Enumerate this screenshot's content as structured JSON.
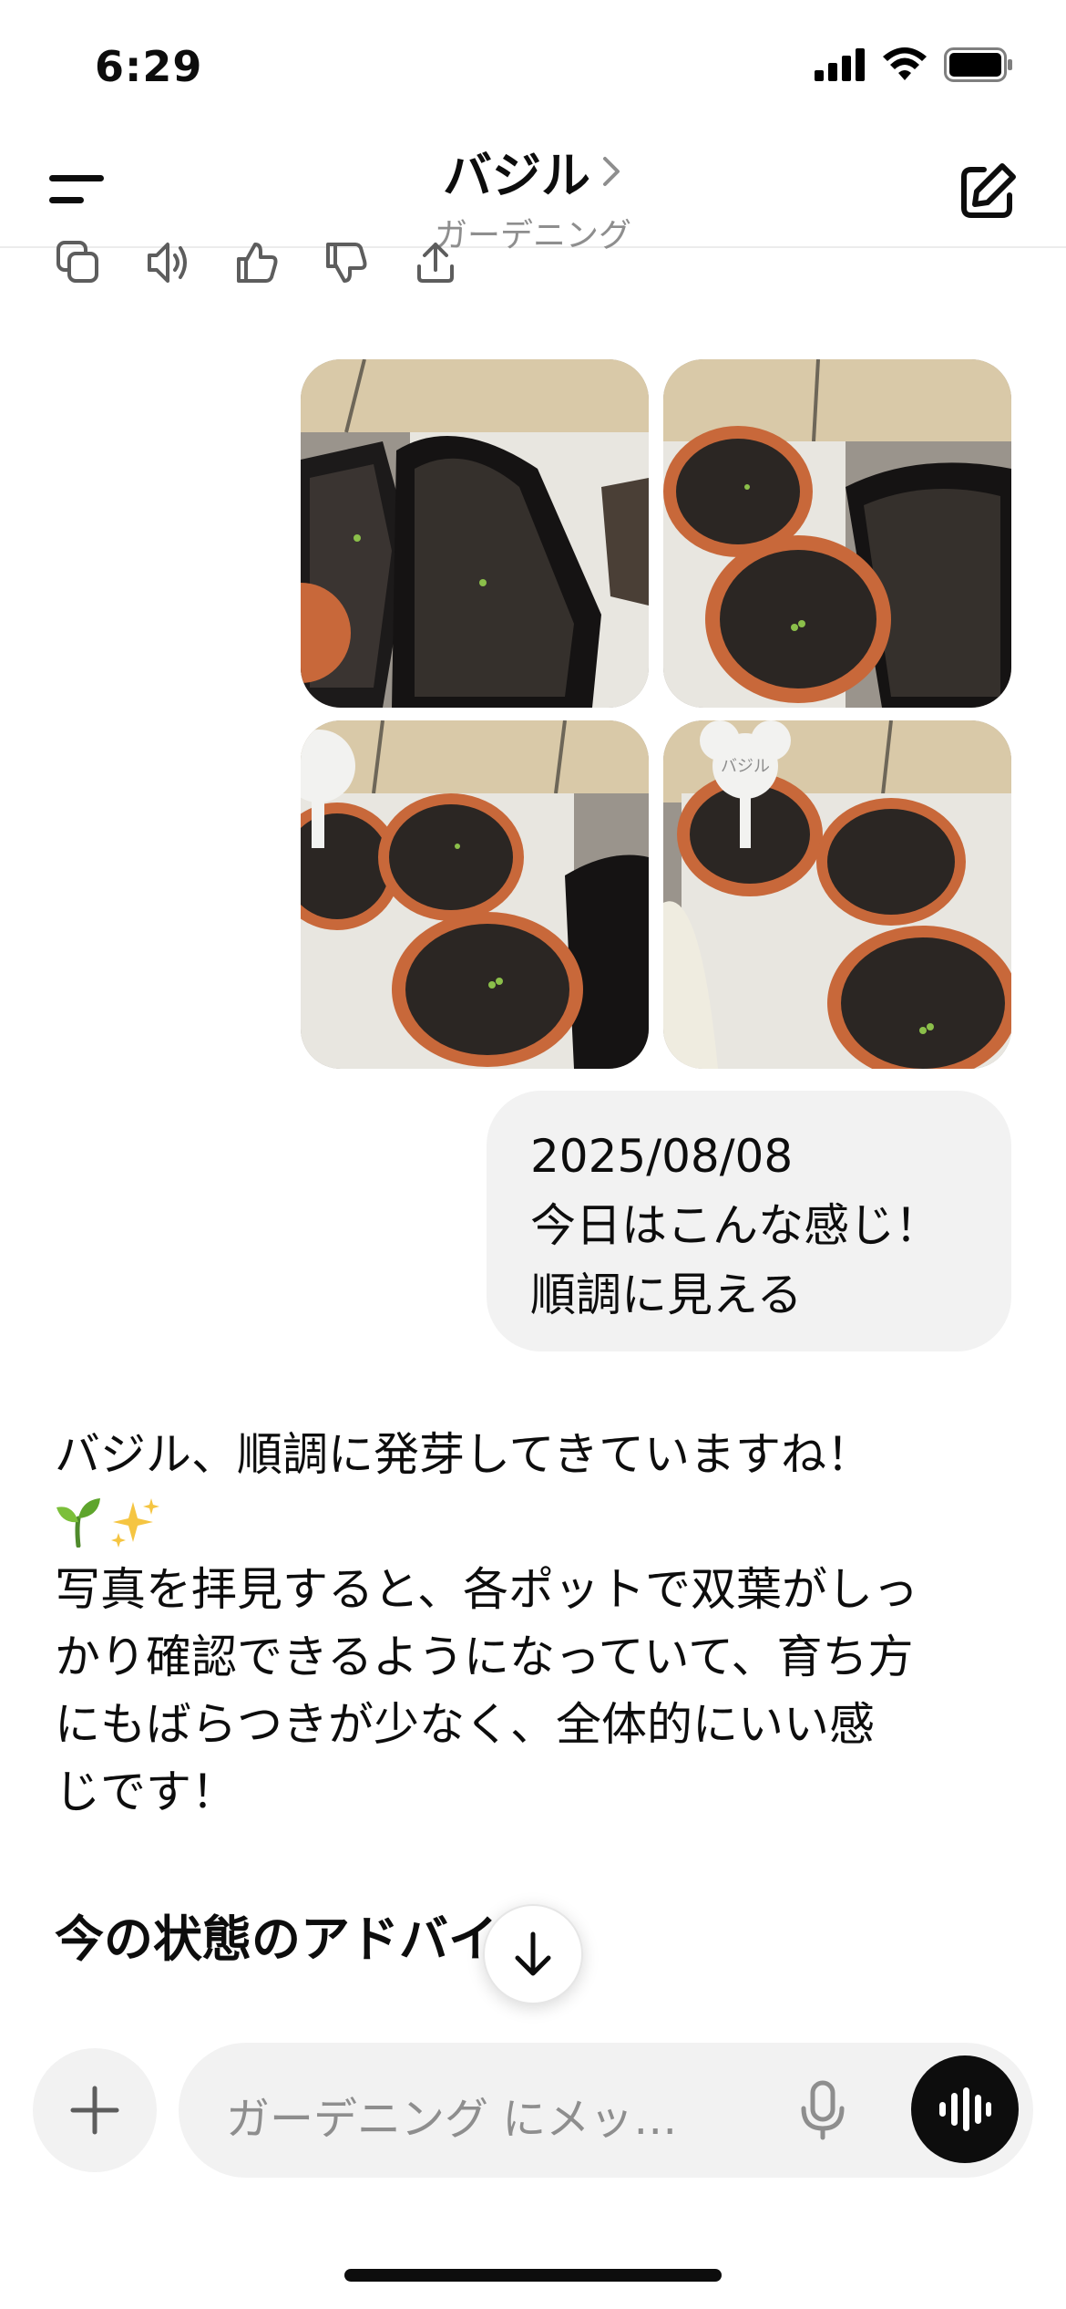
{
  "status_bar": {
    "time": "6:29"
  },
  "header": {
    "title": "バジル",
    "subtitle": "ガーデニング"
  },
  "message_actions": [
    "copy-icon",
    "read-aloud-icon",
    "thumbs-up-icon",
    "thumbs-down-icon",
    "share-icon"
  ],
  "photos": [
    {
      "alt": "basil-photo-1"
    },
    {
      "alt": "basil-photo-2"
    },
    {
      "alt": "basil-photo-3"
    },
    {
      "alt": "basil-photo-4"
    }
  ],
  "photo_label_text": "バジル",
  "user_message": {
    "line1": "2025/08/08",
    "line2": "今日はこんな感じ！",
    "line3": "順調に見える"
  },
  "assistant_message": {
    "line1": "バジル、順調に発芽してきていますね！",
    "emoji": "🌱✨",
    "line2": "写真を拝見すると、各ポットで双葉がしっ",
    "line3": "かり確認できるようになっていて、育ち方",
    "line4": "にもばらつきが少なく、全体的にいい感",
    "line5": "じです！",
    "heading": "今の状態のアドバイス："
  },
  "composer": {
    "placeholder": "ガーデニング にメッ…"
  },
  "colors": {
    "bubble": "#f2f2f2",
    "pot_terracotta": "#c8683a",
    "soil": "#2b2623",
    "accent_dark": "#0d0d0d"
  }
}
